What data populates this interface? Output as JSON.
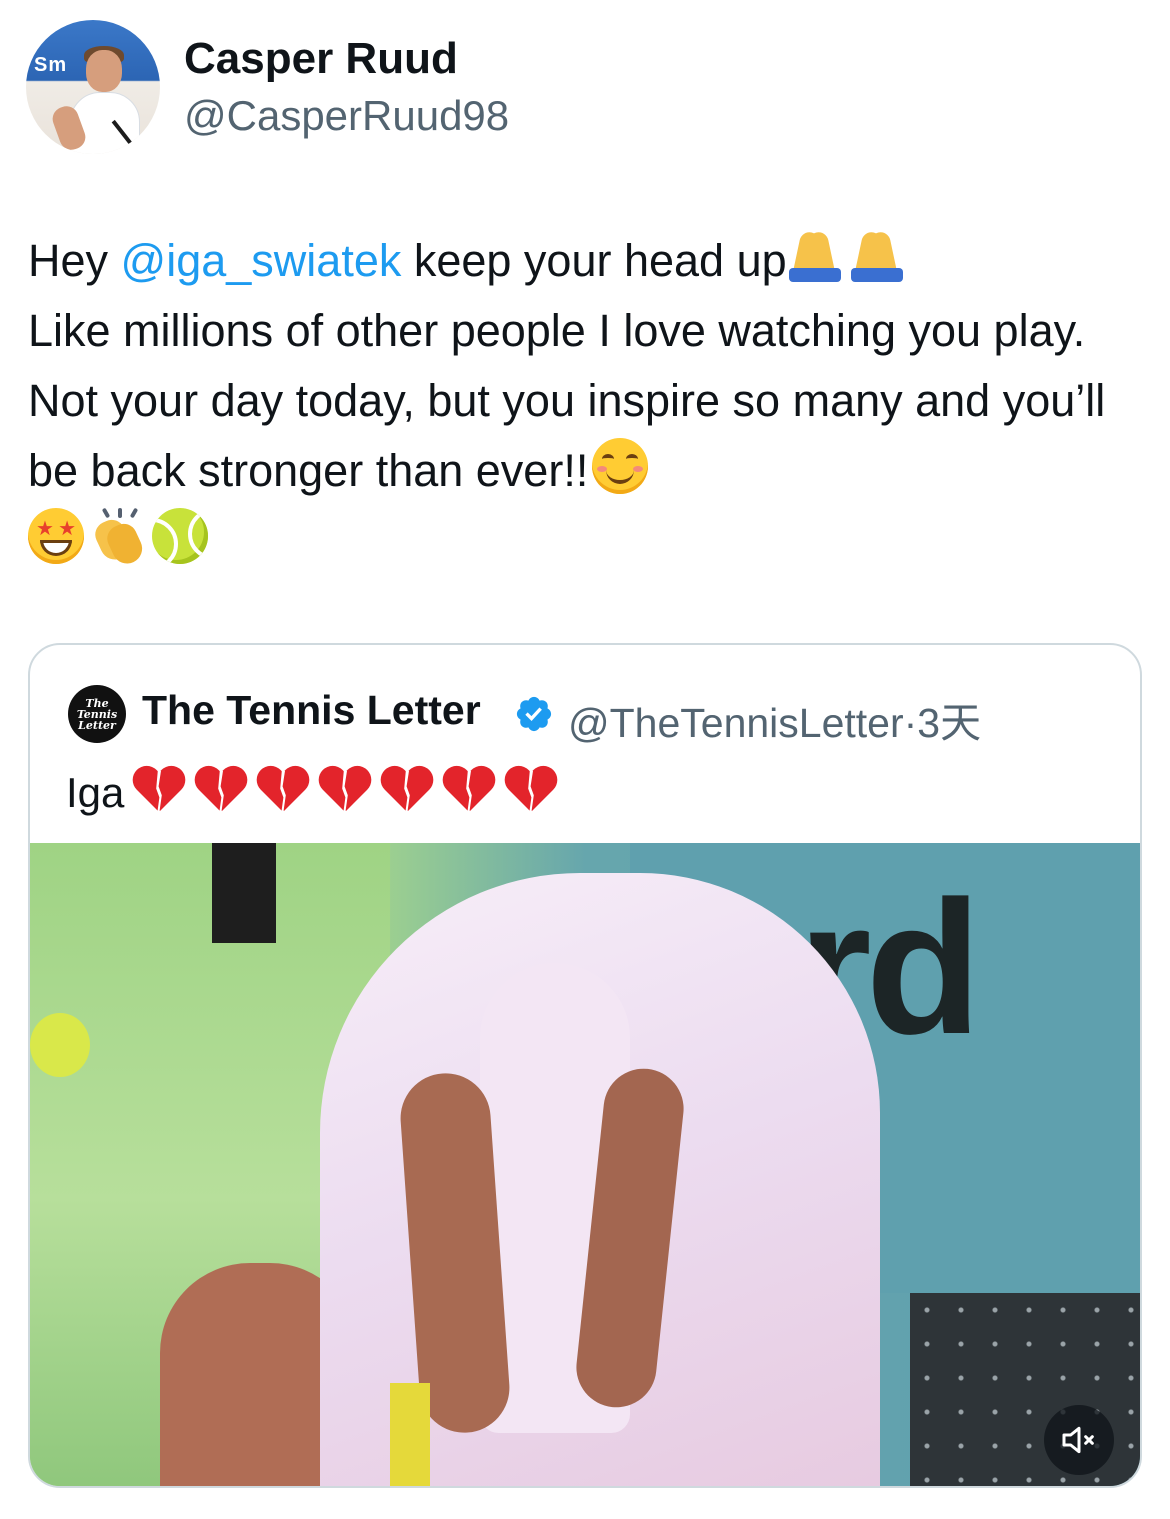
{
  "author": {
    "name": "Casper Ruud",
    "handle": "@CasperRuud98",
    "avatar_icon": "profile-photo-icon",
    "avatar_sign_text": "Sm"
  },
  "tweet": {
    "mention": "@iga_swiatek",
    "line1_prefix": "Hey ",
    "line1_suffix": " keep your head up",
    "body": "Like millions of other people I love watching you play. Not your day today, but you inspire so many and you’ll be back stronger than ever!!",
    "emoji_icons": [
      "folded-hands-icon",
      "folded-hands-icon",
      "smiling-face-icon",
      "star-struck-icon",
      "clapping-hands-icon",
      "tennis-ball-icon"
    ]
  },
  "quoted_tweet": {
    "avatar_text": "The Tennis Letter",
    "name": "The Tennis Letter",
    "verified_icon": "verified-badge-icon",
    "handle": "@TheTennisLetter",
    "separator": "·",
    "time": "3天",
    "text": "Iga",
    "emoji_icons": [
      "broken-heart-icon",
      "broken-heart-icon",
      "broken-heart-icon",
      "broken-heart-icon",
      "broken-heart-icon",
      "broken-heart-icon",
      "broken-heart-icon"
    ],
    "media": {
      "kind": "video",
      "background_text": "erd",
      "mute_icon": "speaker-muted-icon"
    }
  },
  "colors": {
    "text": "#0f1419",
    "secondary": "#536471",
    "link": "#1d9bf0",
    "border": "#cfd9de",
    "verified": "#1d9bf0",
    "heart": "#e3242b"
  }
}
